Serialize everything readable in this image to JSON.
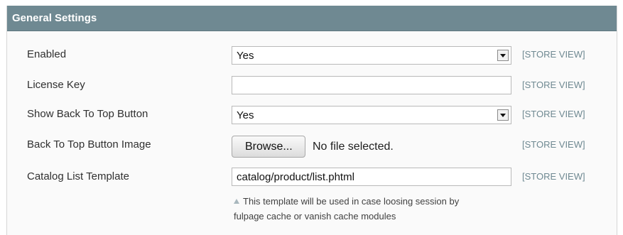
{
  "section": {
    "title": "General Settings"
  },
  "rows": [
    {
      "label": "Enabled",
      "control": "select",
      "value": "Yes",
      "scope": "[STORE VIEW]"
    },
    {
      "label": "License Key",
      "control": "text",
      "value": "",
      "scope": "[STORE VIEW]"
    },
    {
      "label": "Show Back To Top Button",
      "control": "select",
      "value": "Yes",
      "scope": "[STORE VIEW]"
    },
    {
      "label": "Back To Top Button Image",
      "control": "file",
      "button_label": "Browse...",
      "file_status": "No file selected.",
      "scope": "[STORE VIEW]"
    },
    {
      "label": "Catalog List Template",
      "control": "text",
      "value": "catalog/product/list.phtml",
      "scope": "[STORE VIEW]",
      "note_lines": [
        "This template will be used in case loosing session by",
        "fulpage cache or vanish cache modules"
      ]
    }
  ],
  "icons": {
    "select_arrow": "chevron-down-icon",
    "note_marker": "triangle-up-icon"
  },
  "colors": {
    "header_bg": "#6f8992",
    "scope_text": "#6f8992"
  }
}
